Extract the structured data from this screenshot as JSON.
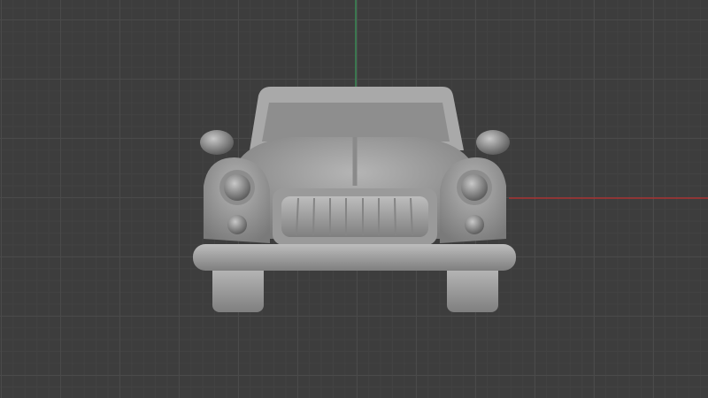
{
  "viewport": {
    "background": "#3d3d3d",
    "axis_colors": {
      "x": "#a83232",
      "y": "#3a8a55"
    },
    "model": "car-front-view"
  }
}
